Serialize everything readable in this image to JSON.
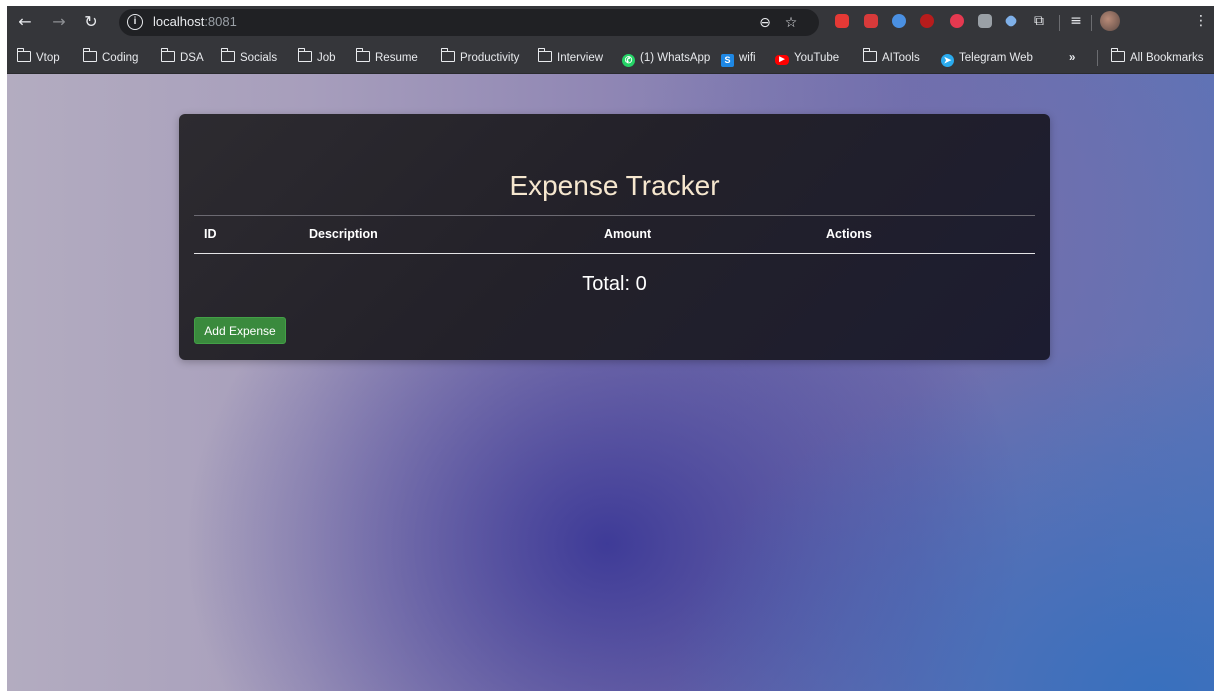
{
  "browser": {
    "url_host": "localhost",
    "url_port": ":8081",
    "bookmarks": [
      {
        "label": "Vtop",
        "type": "folder"
      },
      {
        "label": "Coding",
        "type": "folder"
      },
      {
        "label": "DSA",
        "type": "folder"
      },
      {
        "label": "Socials",
        "type": "folder"
      },
      {
        "label": "Job",
        "type": "folder"
      },
      {
        "label": "Resume",
        "type": "folder"
      },
      {
        "label": "Productivity",
        "type": "folder"
      },
      {
        "label": "Interview",
        "type": "folder"
      },
      {
        "label": "(1) WhatsApp",
        "type": "site"
      },
      {
        "label": "wifi",
        "type": "site"
      },
      {
        "label": "YouTube",
        "type": "site"
      },
      {
        "label": "AITools",
        "type": "folder"
      },
      {
        "label": "Telegram Web",
        "type": "site"
      }
    ],
    "overflow_label": "»",
    "all_bookmarks_label": "All Bookmarks",
    "icons": {
      "back": "arrow-left-icon",
      "forward": "arrow-right-icon",
      "reload": "reload-icon",
      "zoom": "zoom-icon",
      "star": "star-icon",
      "extensions": "puzzle-icon",
      "media": "media-queue-icon",
      "menu": "kebab-menu-icon"
    }
  },
  "app": {
    "title": "Expense Tracker",
    "table": {
      "headers": [
        "ID",
        "Description",
        "Amount",
        "Actions"
      ]
    },
    "total_label": "Total: 0",
    "add_button_label": "Add Expense",
    "colors": {
      "title": "#f6e7cf",
      "button": "#3a8a3d",
      "card": "#25232b"
    }
  }
}
